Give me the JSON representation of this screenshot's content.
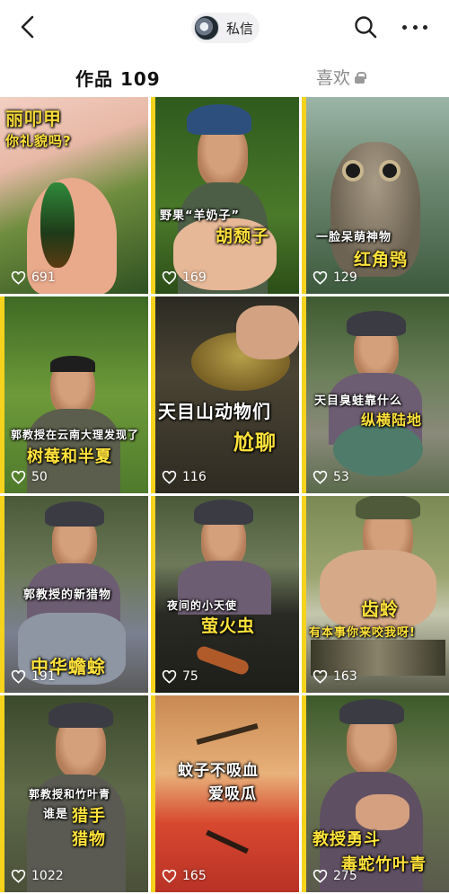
{
  "header": {
    "back_icon": "chevron-left-icon",
    "dm_label": "私信",
    "search_icon": "search-icon",
    "more_icon": "ellipsis-icon"
  },
  "tabs": {
    "works_label": "作品 109",
    "likes_label": "喜欢",
    "likes_lock_icon": "lock-icon"
  },
  "videos": [
    {
      "captions": [
        "丽叩甲",
        "你礼貌吗?"
      ],
      "likes": "691"
    },
    {
      "captions": [
        "野果“羊奶子”",
        "胡颓子"
      ],
      "likes": "169"
    },
    {
      "captions": [
        "一脸呆萌神物",
        "红角鸮"
      ],
      "likes": "129"
    },
    {
      "captions": [
        "郭教授在云南大理发现了",
        "树莓和半夏"
      ],
      "likes": "50"
    },
    {
      "captions": [
        "天目山动物们",
        "尬聊"
      ],
      "likes": "116"
    },
    {
      "captions": [
        "天目臭蛙靠什么",
        "纵横陆地"
      ],
      "likes": "53"
    },
    {
      "captions": [
        "郭教授的新猎物",
        "中华蟾蜍"
      ],
      "likes": "191"
    },
    {
      "captions": [
        "夜间的小天使",
        "萤火虫"
      ],
      "likes": "75"
    },
    {
      "captions": [
        "齿蛉",
        "有本事你来咬我呀!"
      ],
      "likes": "163"
    },
    {
      "captions": [
        "郭教授和竹叶青",
        "谁是",
        "猎手",
        "猎物"
      ],
      "likes": "1022"
    },
    {
      "captions": [
        "蚊子不吸血",
        "爱吸瓜"
      ],
      "likes": "165"
    },
    {
      "captions": [
        "教授勇斗",
        "毒蛇竹叶青"
      ],
      "likes": "275"
    }
  ],
  "colors": {
    "accent_yellow": "#f5d21c",
    "text_dark": "#111111",
    "tab_inactive": "#8a8a8a"
  }
}
